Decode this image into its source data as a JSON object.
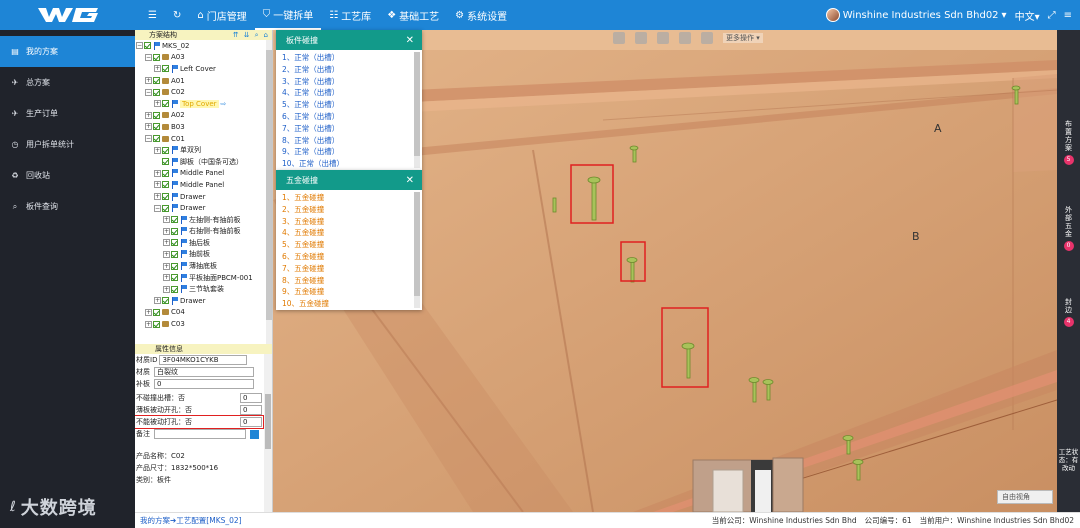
{
  "header": {
    "logo_text": "WG",
    "nav": [
      {
        "icon": "☰",
        "label": ""
      },
      {
        "icon": "↻",
        "label": ""
      },
      {
        "icon": "⌂",
        "label": "门店管理"
      },
      {
        "icon": "⛉",
        "label": "一键拆单"
      },
      {
        "icon": "☷",
        "label": "工艺库"
      },
      {
        "icon": "❖",
        "label": "基础工艺"
      },
      {
        "icon": "⚙",
        "label": "系统设置"
      }
    ],
    "company": "Winshine Industries Sdn Bhd02",
    "language": "中文",
    "fullscreen_icon": "⤢",
    "expand_icon": "≡"
  },
  "sidebar": {
    "items": [
      {
        "icon": "▤",
        "label": "我的方案"
      },
      {
        "icon": "✈",
        "label": "总方案"
      },
      {
        "icon": "✈",
        "label": "生产订单"
      },
      {
        "icon": "◷",
        "label": "用户拆单统计"
      },
      {
        "icon": "♻",
        "label": "回收站"
      },
      {
        "icon": "⌕",
        "label": "板件查询"
      }
    ],
    "watermark": "大数跨境",
    "watermark_logo": "ℓ"
  },
  "tree": {
    "title": "方案结构",
    "tools": [
      "⇈",
      "⇊",
      "⌕",
      "⌂"
    ],
    "rows": [
      {
        "indent": 0,
        "toggle": "⊟",
        "icon": "flag",
        "label": "MKS_02"
      },
      {
        "indent": 1,
        "toggle": "⊟",
        "icon": "box",
        "label": "A03"
      },
      {
        "indent": 2,
        "toggle": "⊞",
        "icon": "flag",
        "label": "Left Cover"
      },
      {
        "indent": 1,
        "toggle": "⊞",
        "icon": "box",
        "label": "A01"
      },
      {
        "indent": 1,
        "toggle": "⊟",
        "icon": "box",
        "label": "C02"
      },
      {
        "indent": 2,
        "toggle": "⊞",
        "icon": "flag",
        "label": "Top Cover",
        "highlight": true
      },
      {
        "indent": 1,
        "toggle": "⊞",
        "icon": "box",
        "label": "A02"
      },
      {
        "indent": 1,
        "toggle": "⊞",
        "icon": "box",
        "label": "B03"
      },
      {
        "indent": 1,
        "toggle": "⊟",
        "icon": "box",
        "label": "C01"
      },
      {
        "indent": 2,
        "toggle": "⊞",
        "icon": "flag",
        "label": "单双列"
      },
      {
        "indent": 2,
        "toggle": "",
        "icon": "flag",
        "label": "脚板（中国条可选）"
      },
      {
        "indent": 2,
        "toggle": "⊞",
        "icon": "flag",
        "label": "Middle Panel"
      },
      {
        "indent": 2,
        "toggle": "⊞",
        "icon": "flag",
        "label": "Middle Panel"
      },
      {
        "indent": 2,
        "toggle": "⊞",
        "icon": "flag",
        "label": "Drawer"
      },
      {
        "indent": 2,
        "toggle": "⊟",
        "icon": "flag",
        "label": "Drawer"
      },
      {
        "indent": 3,
        "toggle": "⊞",
        "icon": "flag",
        "label": "左抽侧-有抽前板"
      },
      {
        "indent": 3,
        "toggle": "⊞",
        "icon": "flag",
        "label": "右抽侧-有抽前板"
      },
      {
        "indent": 3,
        "toggle": "⊞",
        "icon": "flag",
        "label": "抽后板"
      },
      {
        "indent": 3,
        "toggle": "⊞",
        "icon": "flag",
        "label": "抽前板"
      },
      {
        "indent": 3,
        "toggle": "⊞",
        "icon": "flag",
        "label": "薄抽底板"
      },
      {
        "indent": 3,
        "toggle": "⊞",
        "icon": "flag",
        "label": "平板抽面PBCM-001"
      },
      {
        "indent": 3,
        "toggle": "⊞",
        "icon": "flag",
        "label": "三节轨套装"
      },
      {
        "indent": 2,
        "toggle": "⊞",
        "icon": "flag",
        "label": "Drawer"
      },
      {
        "indent": 1,
        "toggle": "⊞",
        "icon": "box",
        "label": "C04"
      },
      {
        "indent": 1,
        "toggle": "⊞",
        "icon": "box",
        "label": "C03"
      }
    ]
  },
  "properties": {
    "title": "属性信息",
    "material_id_label": "材质ID",
    "material_id_value": "3F04MKO1CYKB",
    "material_label": "材质",
    "material_value": "白裂纹",
    "patch_label": "补板",
    "patch_value": "0",
    "no_notch_label": "不碰撞出槽：否",
    "no_notch_value": "0",
    "thin_auto_label": "薄板被动开孔：否",
    "thin_auto_value": "0",
    "no_drill_label": "不能被动打孔：否",
    "no_drill_value": "0",
    "remark_label": "备注",
    "remark_value": "",
    "product_name": "产品名称：C02",
    "product_size": "产品尺寸：1832*500*16",
    "category": "类别：板件"
  },
  "popup_panels": {
    "title": "板件碰撞",
    "items": [
      "1、正常（出槽）",
      "2、正常（出槽）",
      "3、正常（出槽）",
      "4、正常（出槽）",
      "5、正常（出槽）",
      "6、正常（出槽）",
      "7、正常（出槽）",
      "8、正常（出槽）",
      "9、正常（出槽）",
      "10、正常（出槽）"
    ]
  },
  "popup_hardware": {
    "title": "五金碰撞",
    "items": [
      "1、五金碰撞",
      "2、五金碰撞",
      "3、五金碰撞",
      "4、五金碰撞",
      "5、五金碰撞",
      "6、五金碰撞",
      "7、五金碰撞",
      "8、五金碰撞",
      "9、五金碰撞",
      "10、五金碰撞"
    ]
  },
  "viewport": {
    "more_ops": "更多操作 ▾",
    "label_a": "A",
    "label_b": "B",
    "angle_select": "自由视角"
  },
  "right_strip": [
    {
      "label": "布置方案",
      "count": "5"
    },
    {
      "label": "外部五金",
      "count": "0"
    },
    {
      "label": "封边",
      "count": "4"
    },
    {
      "label": "工艺状态：有改动",
      "count": ""
    }
  ],
  "statusbar": {
    "path_left": "我的方案",
    "arrow": "➔",
    "path_right": "工艺配置[MKS_02]",
    "company": "当前公司：Winshine Industries Sdn Bhd",
    "company_code": "公司编号：61",
    "current_user": "当前用户：Winshine Industries Sdn Bhd02"
  },
  "colors": {
    "brand": "#1e85d6",
    "teal": "#129a8a",
    "sidebar_bg": "#20232b",
    "wood": "#d9a77a",
    "alert": "#e02020",
    "badge": "#e8336b"
  }
}
